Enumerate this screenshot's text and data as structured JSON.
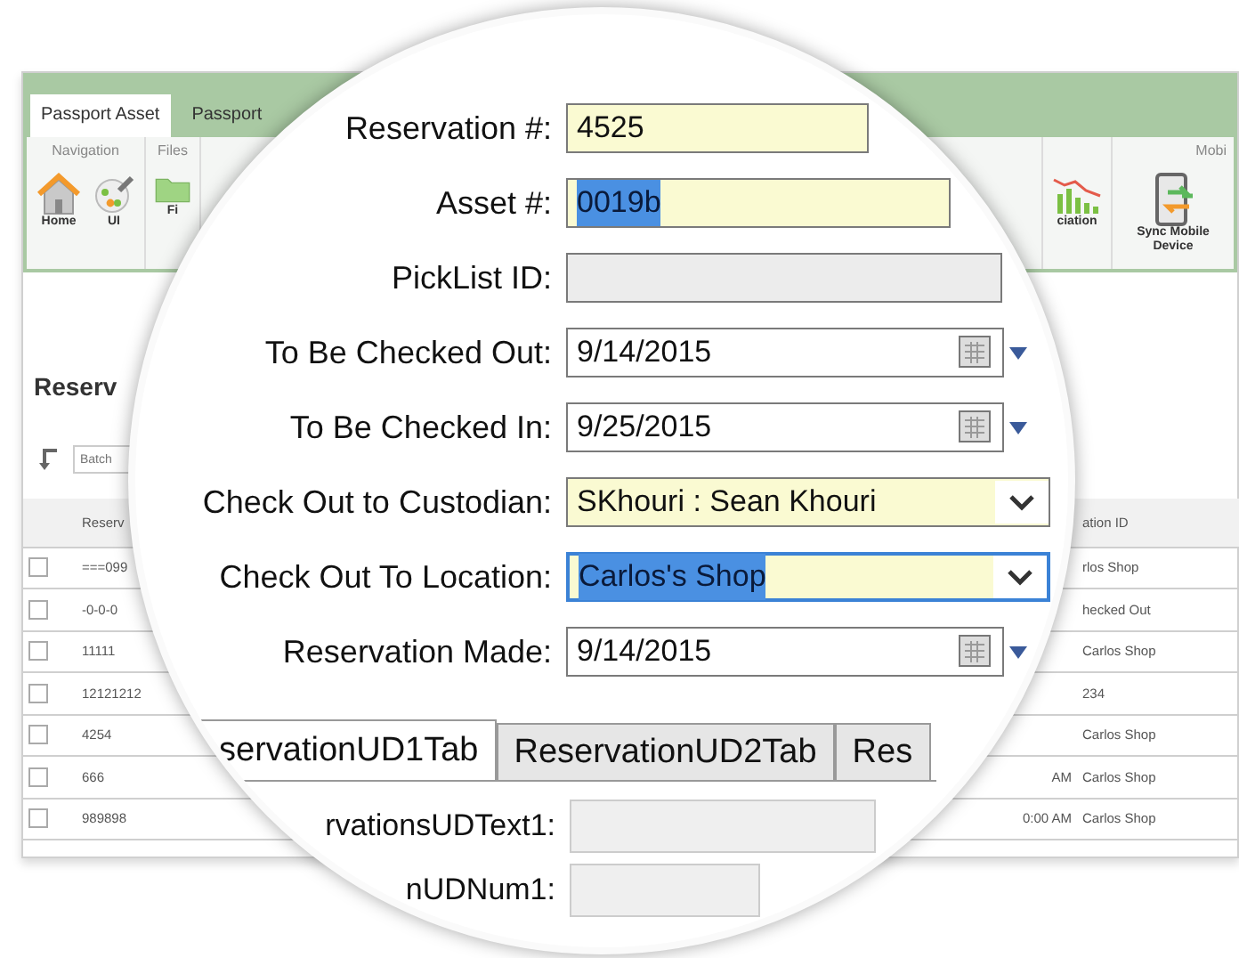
{
  "ribbon": {
    "tabs": [
      {
        "label": "Passport Asset",
        "selected": true
      },
      {
        "label": "Passport",
        "selected": false
      }
    ],
    "groups": [
      {
        "label": "Navigation",
        "buttons": [
          {
            "label": "Home",
            "kind": "home"
          },
          {
            "label": "UI",
            "kind": "palette"
          }
        ]
      },
      {
        "label": "Files",
        "buttons": [
          {
            "label": "Fi",
            "kind": "folder"
          }
        ]
      },
      {
        "buttons": [
          {
            "label": "ciation",
            "kind": "chart"
          }
        ]
      },
      {
        "label": "Mobi",
        "buttons": [
          {
            "label": "Sync Mobile Device",
            "kind": "sync"
          }
        ]
      }
    ]
  },
  "page_title": "Reserv",
  "batch_field": {
    "placeholder": "Batch"
  },
  "table": {
    "columns": {
      "column_1": "Reserv",
      "column_3": "ation ID"
    },
    "rows": [
      {
        "checked": false,
        "column_1": "===099",
        "column_3": "rlos Shop"
      },
      {
        "checked": false,
        "column_1": "-0-0-0",
        "column_3": "hecked Out"
      },
      {
        "checked": false,
        "column_1": "11111",
        "column_3": "Carlos Shop"
      },
      {
        "checked": false,
        "column_1": "12121212",
        "column_3": "234"
      },
      {
        "checked": false,
        "column_1": "4254",
        "column_3": "Carlos Shop"
      },
      {
        "checked": false,
        "column_1": "666",
        "column_2": "AM",
        "column_3": "Carlos Shop"
      },
      {
        "checked": false,
        "column_1": "989898",
        "column_2": "0:00 AM",
        "column_3": "Carlos Shop"
      }
    ]
  },
  "magnifier": {
    "fields": [
      {
        "label": "Reservation #:",
        "kind": "text",
        "value": "4525",
        "text_selected": false,
        "focused": false
      },
      {
        "label": "Asset #:",
        "kind": "text",
        "value": "0019b",
        "text_selected": true,
        "focused": false
      },
      {
        "label": "PickList ID:",
        "kind": "readonly",
        "focused": false
      },
      {
        "label": "To Be Checked Out:",
        "kind": "date",
        "value": "9/14/2015",
        "text_selected": false,
        "focused": false
      },
      {
        "label": "To Be Checked In:",
        "kind": "date",
        "value": "9/25/2015",
        "text_selected": false,
        "focused": false
      },
      {
        "label": "Check Out to Custodian:",
        "kind": "combo",
        "value": "SKhouri : Sean Khouri",
        "text_selected": false,
        "focused": false
      },
      {
        "label": "Check Out To Location:",
        "kind": "combo",
        "value": "Carlos's Shop",
        "text_selected": true,
        "focused": true
      },
      {
        "label": "Reservation Made:",
        "kind": "date",
        "value": "9/14/2015",
        "text_selected": false,
        "focused": false
      }
    ],
    "tabs": [
      {
        "label": "servationUD1Tab",
        "selected": true
      },
      {
        "label": "ReservationUD2Tab",
        "selected": false
      },
      {
        "label": "Res",
        "selected": false
      }
    ],
    "tab_fields": [
      {
        "label": "rvationsUDText1:"
      },
      {
        "label": "nUDNum1:"
      }
    ]
  }
}
